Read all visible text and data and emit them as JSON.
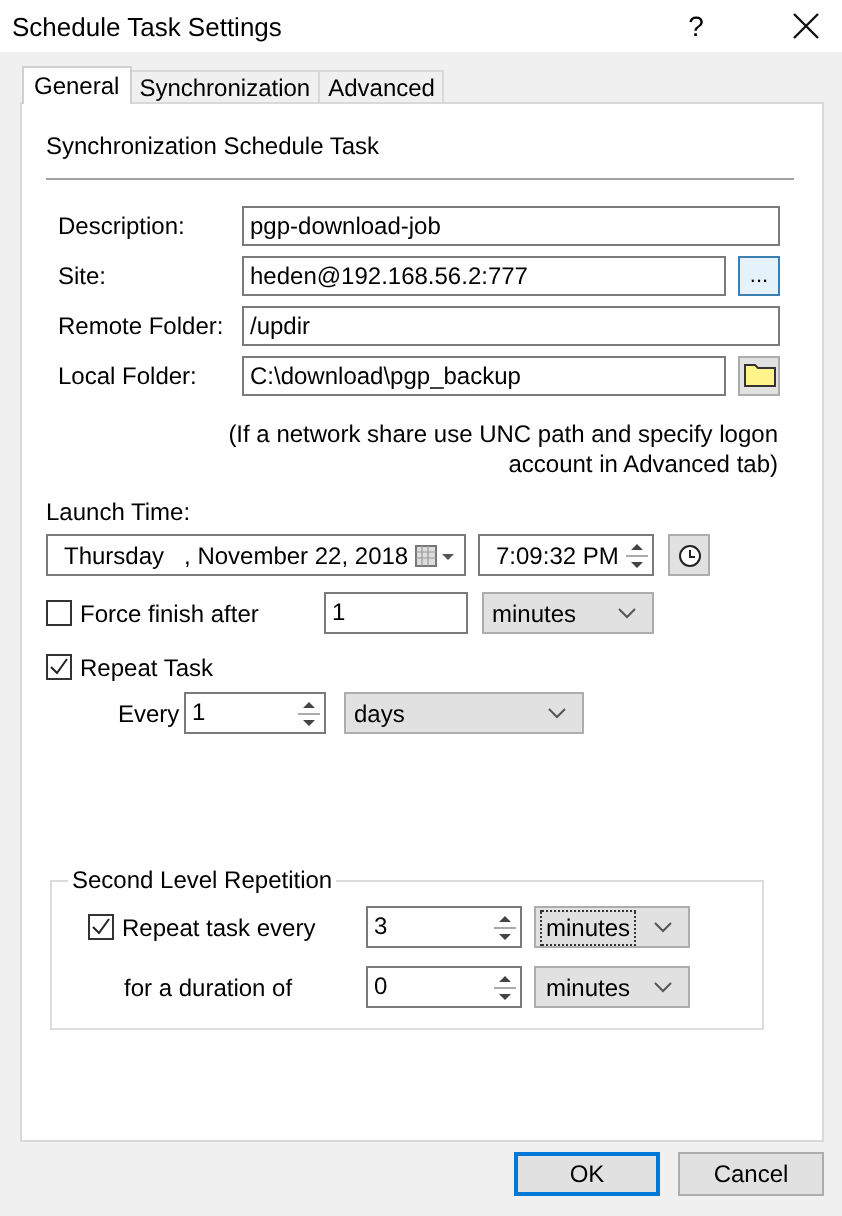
{
  "window": {
    "title": "Schedule Task Settings",
    "help": "?"
  },
  "tabs": [
    {
      "label": "General",
      "selected": true
    },
    {
      "label": "Synchronization",
      "selected": false
    },
    {
      "label": "Advanced",
      "selected": false
    }
  ],
  "section_title": "Synchronization Schedule Task",
  "fields": [
    {
      "label": "Description:",
      "value": "pgp-download-job",
      "kind": "text"
    },
    {
      "label": "Site:",
      "value": "heden@192.168.56.2:777",
      "kind": "browse",
      "button": "..."
    },
    {
      "label": "Remote Folder:",
      "value": "/updir",
      "kind": "text"
    },
    {
      "label": "Local Folder:",
      "value": "C:\\download\\pgp_backup",
      "kind": "folder"
    }
  ],
  "note": "(If a network share use UNC path and specify logon account in Advanced tab)",
  "launch_time": {
    "label": "Launch Time:",
    "date": "Thursday   , November 22, 2018",
    "time": "7:09:32 PM"
  },
  "force_finish": {
    "label": "Force finish after",
    "checked": false,
    "value": "1",
    "unit": "minutes"
  },
  "repeat_task": {
    "label": "Repeat Task",
    "checked": true,
    "every_label": "Every",
    "value": "1",
    "unit": "days"
  },
  "second_level": {
    "title": "Second Level Repetition",
    "repeat": {
      "label": "Repeat task every",
      "checked": true,
      "value": "3",
      "unit": "minutes",
      "focused": true
    },
    "duration": {
      "label": "for a duration of",
      "value": "0",
      "unit": "minutes",
      "focused": false
    }
  },
  "buttons": [
    {
      "label": "OK",
      "default": true
    },
    {
      "label": "Cancel",
      "default": false
    }
  ]
}
